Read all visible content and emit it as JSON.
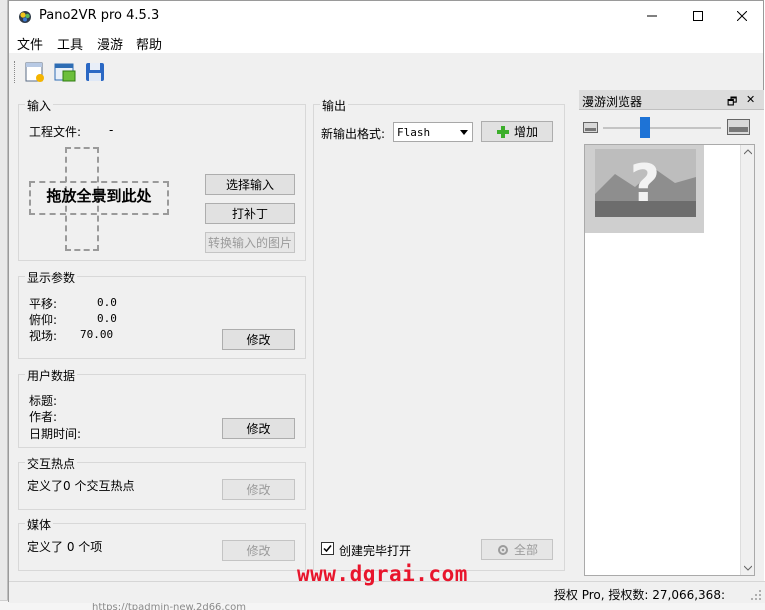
{
  "window": {
    "title": "Pano2VR pro 4.5.3"
  },
  "background": {
    "url_fragment": "https://tpadmin-new.2d66.com"
  },
  "menu": [
    "文件",
    "工具",
    "漫游",
    "帮助"
  ],
  "toolbar": {
    "icons": [
      "new-project-icon",
      "open-project-icon",
      "save-project-icon"
    ]
  },
  "input_panel": {
    "title": "输入",
    "project_file_label": "工程文件:",
    "project_file_value": "-",
    "drop_text": "拖放全景到此处",
    "select_input": "选择输入",
    "patch": "打补丁",
    "convert": "转换输入的图片"
  },
  "display_panel": {
    "title": "显示参数",
    "pan_label": "平移:",
    "pan_value": "0.0",
    "tilt_label": "俯仰:",
    "tilt_value": "0.0",
    "fov_label": "视场:",
    "fov_value": "70.00",
    "modify": "修改"
  },
  "user_panel": {
    "title": "用户数据",
    "title_label": "标题:",
    "author_label": "作者:",
    "datetime_label": "日期时间:",
    "modify": "修改"
  },
  "hotspot_panel": {
    "title": "交互热点",
    "text": "定义了0 个交互热点",
    "modify": "修改"
  },
  "media_panel": {
    "title": "媒体",
    "text": "定义了 0 个项",
    "modify": "修改"
  },
  "output_panel": {
    "title": "输出",
    "format_label": "新输出格式:",
    "format_value": "Flash",
    "add": "增加",
    "open_after": "创建完毕打开",
    "open_after_checked": true,
    "all": "全部"
  },
  "browser_panel": {
    "title": "漫游浏览器"
  },
  "status": {
    "text": "授权 Pro, 授权数: 27,066,368:"
  },
  "watermark": "www.dgrai.com",
  "colors": {
    "watermark": "#e8152c",
    "green_plus": "#3cae2b",
    "slider_thumb": "#1e73d6"
  }
}
